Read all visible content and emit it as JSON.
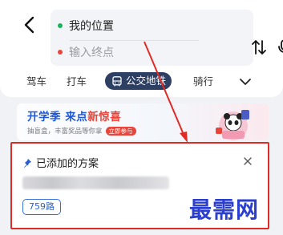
{
  "route": {
    "start_label": "我的位置",
    "end_placeholder": "输入终点"
  },
  "tabs": [
    {
      "label": "驾车",
      "selected": false
    },
    {
      "label": "打车",
      "selected": false
    },
    {
      "label": "公交地铁",
      "selected": true
    },
    {
      "label": "骑行",
      "selected": false
    }
  ],
  "banner": {
    "title_part1": "开学季 来点",
    "title_part2": "新惊喜",
    "subtitle": "抽盲盒，丰富奖品等你拿",
    "cta": "立即参与"
  },
  "plan_panel": {
    "title": "已添加的方案",
    "route_chip": "759路"
  },
  "watermark": "最需网",
  "colors": {
    "accent_navy": "#2d3f63",
    "annotation_red": "#e02a25",
    "link_blue": "#2b5fcc"
  },
  "icons": [
    "back-arrow-icon",
    "swap-icon",
    "microphone-icon",
    "bus-icon",
    "chevron-down-icon",
    "pin-icon",
    "close-icon"
  ]
}
